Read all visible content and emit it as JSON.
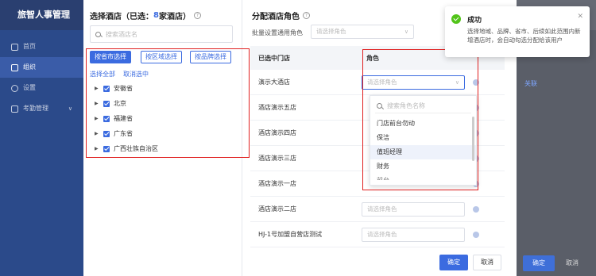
{
  "app": {
    "title": "旅智人事管理"
  },
  "sidebar": {
    "items": [
      {
        "label": "首页",
        "icon": "home-icon"
      },
      {
        "label": "组织",
        "icon": "org-icon",
        "active": true
      },
      {
        "label": "设置",
        "icon": "gear-icon"
      },
      {
        "label": "考勤管理",
        "icon": "attendance-icon",
        "caret": "∨"
      }
    ]
  },
  "background": {
    "link": "关联",
    "confirm": "确定",
    "cancel": "取消"
  },
  "left_panel": {
    "title_prefix": "选择酒店（已选：",
    "selected_count": "8",
    "title_suffix": "家酒店）",
    "help": "?",
    "search_placeholder": "搜索酒店名",
    "mode_buttons": [
      "按省市选择",
      "按区域选择",
      "按品牌选择"
    ],
    "select_all": "选择全部",
    "deselect": "取消选中",
    "provinces": [
      "安徽省",
      "北京",
      "福建省",
      "广东省",
      "广西壮族自治区"
    ]
  },
  "right_panel": {
    "title": "分配酒店角色",
    "batch_label": "批量设置通用角色",
    "batch_placeholder": "请选择角色",
    "col_store": "已选中门店",
    "col_role": "角色",
    "role_placeholder": "请选择角色",
    "rows": [
      "演示大酒店",
      "酒店演示五店",
      "酒店演示四店",
      "酒店演示三店",
      "酒店演示一店",
      "酒店演示二店",
      "HJ-1号加盟自营店测试"
    ],
    "dropdown": {
      "search_placeholder": "搜索角色名称",
      "options": [
        "门店前台勿动",
        "保洁",
        "值班经理",
        "财务"
      ],
      "cut_option": "前台",
      "hovered": "值班经理"
    },
    "ok": "确定",
    "cancel": "取消"
  },
  "toast": {
    "title": "成功",
    "message": "选择地域、品牌、省市、后续如此范围内新增酒店时，会自动勾选分配给该用户",
    "close": "✕"
  },
  "colors": {
    "accent": "#3b6be0",
    "highlight": "#e02020",
    "success": "#52c41a"
  }
}
